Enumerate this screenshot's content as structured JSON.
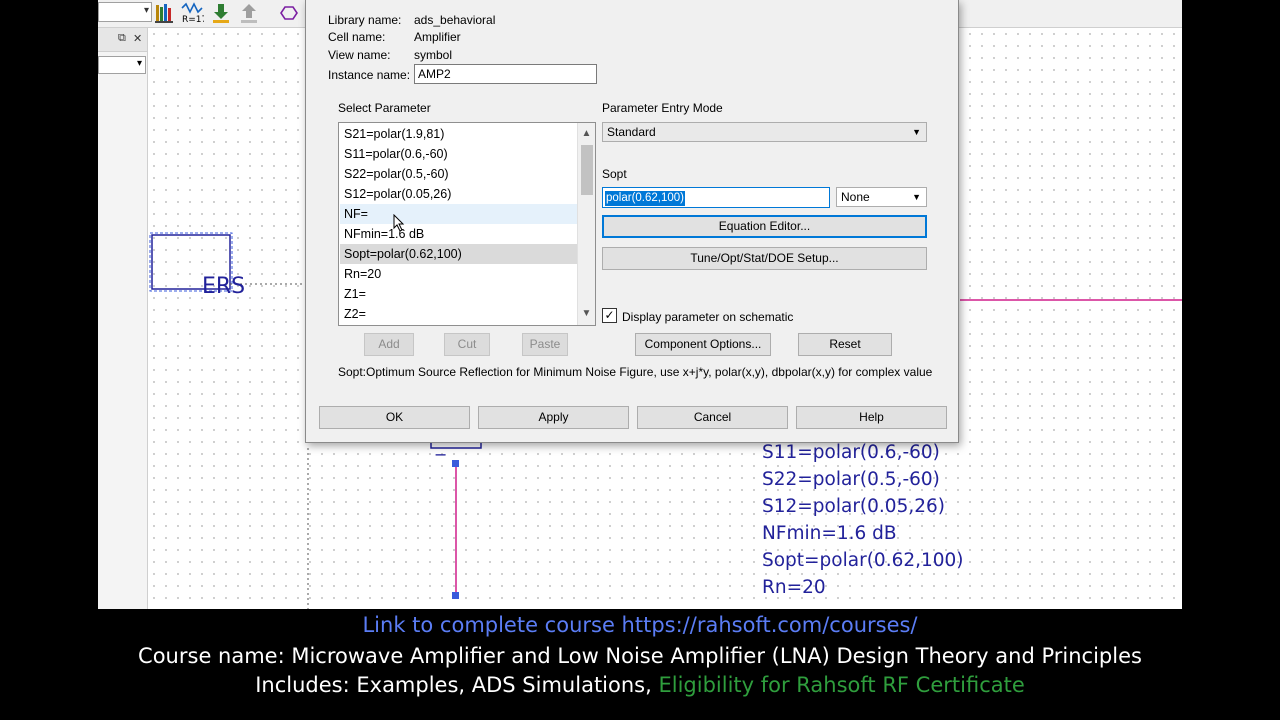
{
  "dialog": {
    "library_label": "Library name:",
    "library_value": "ads_behavioral",
    "cell_label": "Cell name:",
    "cell_value": "Amplifier",
    "view_label": "View name:",
    "view_value": "symbol",
    "instance_label": "Instance name:",
    "instance_value": "AMP2",
    "select_parameter_label": "Select Parameter",
    "parameters": [
      "S21=polar(1.9,81)",
      "S11=polar(0.6,-60)",
      "S22=polar(0.5,-60)",
      "S12=polar(0.05,26)",
      "NF=",
      "NFmin=1.6 dB",
      "Sopt=polar(0.62,100)",
      "Rn=20",
      "Z1=",
      "Z2="
    ],
    "hovered_parameter_index": 4,
    "selected_parameter_index": 6,
    "entry_mode_label": "Parameter Entry Mode",
    "entry_mode_value": "Standard",
    "param_name_label": "Sopt",
    "param_value": "polar(0.62,100)",
    "unit_value": "None",
    "equation_editor_button": "Equation Editor...",
    "tune_button": "Tune/Opt/Stat/DOE Setup...",
    "display_checkbox_label": "Display parameter on schematic",
    "display_checkbox_checked": true,
    "add_button": "Add",
    "cut_button": "Cut",
    "paste_button": "Paste",
    "component_options_button": "Component Options...",
    "reset_button": "Reset",
    "description": "Sopt:Optimum Source Reflection for Minimum Noise Figure, use x+j*y, polar(x,y), dbpolar(x,y) for complex value",
    "ok_button": "OK",
    "apply_button": "Apply",
    "cancel_button": "Cancel",
    "help_button": "Help"
  },
  "schematic": {
    "partial_label": "ERS",
    "minus_sign": "−",
    "component_params": [
      "S11=polar(0.6,-60)",
      "S22=polar(0.5,-60)",
      "S12=polar(0.05,26)",
      "NFmin=1.6 dB",
      "Sopt=polar(0.62,100)",
      "Rn=20"
    ],
    "toolbar_icons": [
      "library-icon",
      "resistor-icon",
      "download-icon",
      "upload-icon",
      "port-icon"
    ],
    "toolbar_icon_text": "R=17",
    "colors": {
      "wire": "#d01e8c",
      "component": "#22229a",
      "port": "#3b5bdb"
    }
  },
  "captions": {
    "course_link": "Link to complete course https://rahsoft.com/courses/",
    "course_name": "Course name: Microwave Amplifier and Low Noise Amplifier (LNA) Design Theory and Principles",
    "includes_prefix": "Includes: Examples, ADS Simulations,",
    "includes_highlight": "Eligibility for Rahsoft RF Certificate",
    "link_color": "#5b7df5",
    "highlight_color": "#2f9e3d"
  }
}
